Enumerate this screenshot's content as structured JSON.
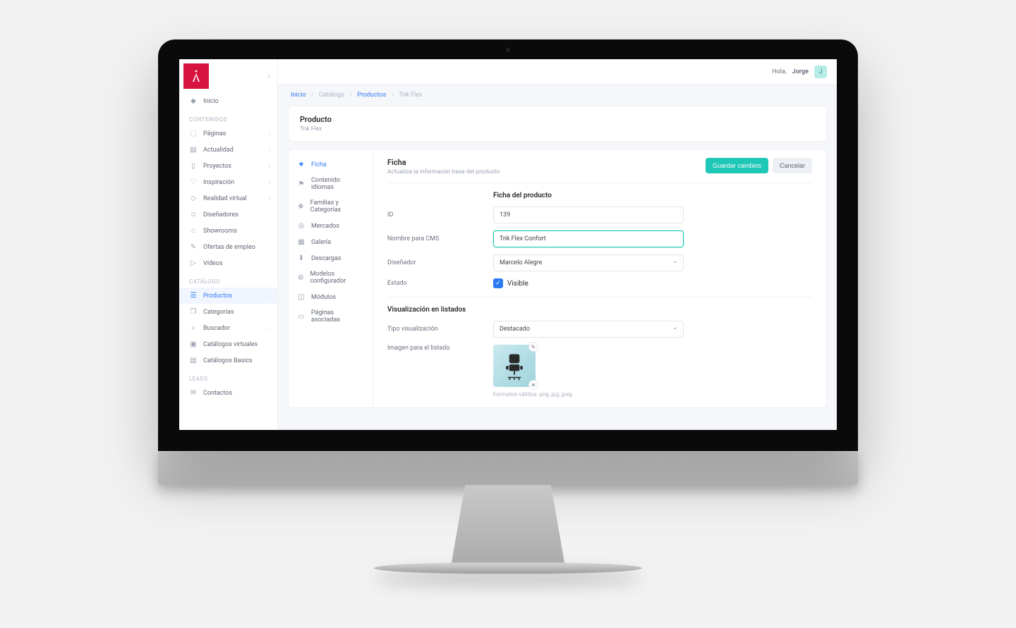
{
  "topbar": {
    "greeting": "Hola,",
    "username": "Jorge",
    "avatar_initial": "J"
  },
  "breadcrumbs": [
    {
      "label": "Inicio",
      "muted": false
    },
    {
      "label": "Catálogo",
      "muted": true
    },
    {
      "label": "Productos",
      "muted": false
    },
    {
      "label": "Tnk Flex",
      "muted": true
    }
  ],
  "sidebar": {
    "home": {
      "label": "Inicio"
    },
    "sections": [
      {
        "title": "CONTENIDOS",
        "items": [
          {
            "label": "Páginas",
            "icon": "⬚",
            "chev": true
          },
          {
            "label": "Actualidad",
            "icon": "▤",
            "chev": true
          },
          {
            "label": "Proyectos",
            "icon": "▯",
            "chev": true
          },
          {
            "label": "Inspiración",
            "icon": "♡",
            "chev": true
          },
          {
            "label": "Realidad virtual",
            "icon": "◇",
            "chev": true
          },
          {
            "label": "Diseñadores",
            "icon": "☺",
            "chev": false
          },
          {
            "label": "Showrooms",
            "icon": "⌂",
            "chev": false
          },
          {
            "label": "Ofertas de empleo",
            "icon": "✎",
            "chev": false
          },
          {
            "label": "Vídeos",
            "icon": "▷",
            "chev": false
          }
        ]
      },
      {
        "title": "CATÁLOGO",
        "items": [
          {
            "label": "Productos",
            "icon": "☰",
            "chev": true,
            "active": true
          },
          {
            "label": "Categorías",
            "icon": "❐",
            "chev": false
          },
          {
            "label": "Buscador",
            "icon": "⌕",
            "chev": true
          },
          {
            "label": "Catálogos virtuales",
            "icon": "▣",
            "chev": false
          },
          {
            "label": "Catálogos Basics",
            "icon": "▤",
            "chev": false
          }
        ]
      },
      {
        "title": "LEADS",
        "items": [
          {
            "label": "Contactos",
            "icon": "✉",
            "chev": false
          }
        ]
      }
    ]
  },
  "header_card": {
    "title": "Producto",
    "subtitle": "Tnk Flex"
  },
  "editor_tabs": [
    {
      "label": "Ficha",
      "icon": "★",
      "active": true
    },
    {
      "label": "Contenido idiomas",
      "icon": "⚑"
    },
    {
      "label": "Familias y Categorías",
      "icon": "❖"
    },
    {
      "label": "Mercados",
      "icon": "◎"
    },
    {
      "label": "Galería",
      "icon": "▦"
    },
    {
      "label": "Descargas",
      "icon": "⬇"
    },
    {
      "label": "Modelos configurador",
      "icon": "⚙"
    },
    {
      "label": "Módulos",
      "icon": "◫"
    },
    {
      "label": "Páginas asociadas",
      "icon": "▭"
    }
  ],
  "editor_head": {
    "title": "Ficha",
    "subtitle": "Actualiza la informacón base del producto",
    "save_label": "Guardar cambios",
    "cancel_label": "Cancelar"
  },
  "form": {
    "section1_title": "Ficha del producto",
    "id_label": "ID",
    "id_value": "139",
    "name_label": "Nombre para CMS",
    "name_value": "Tnk Flex Confort",
    "designer_label": "Diseñador",
    "designer_value": "Marcelo Alegre",
    "state_label": "Estado",
    "state_checkbox_label": "Visible",
    "section2_title": "Visualización en listados",
    "vistype_label": "Tipo visualización",
    "vistype_value": "Destacado",
    "thumb_label": "Imagen para el listado",
    "thumb_hint": "Formatos válidos: png, jpg, jpeg"
  }
}
